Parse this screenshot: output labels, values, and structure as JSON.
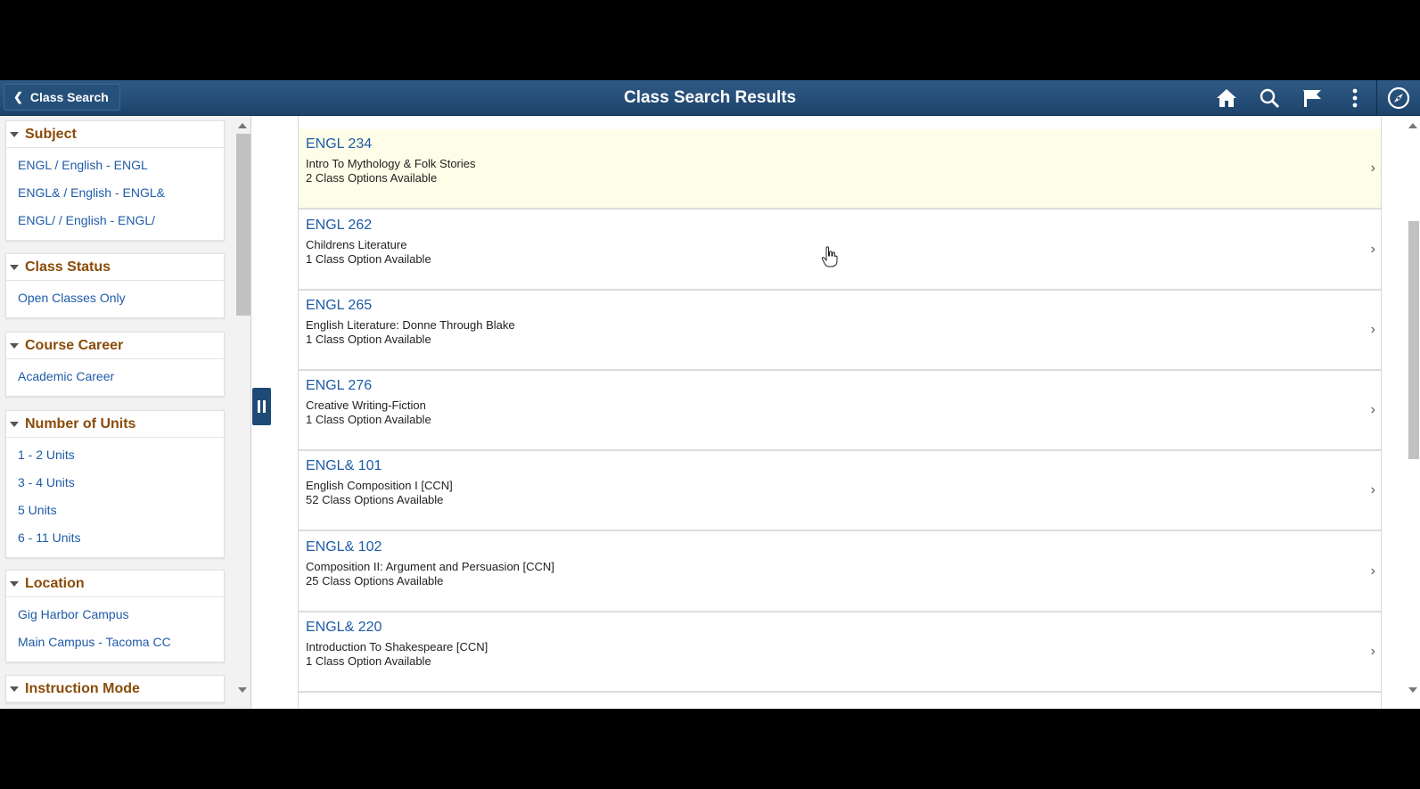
{
  "header": {
    "back_label": "Class Search",
    "title": "Class Search Results",
    "icons": [
      "home-icon",
      "search-icon",
      "flag-icon",
      "more-vertical-icon",
      "navigator-compass-icon"
    ]
  },
  "facets": [
    {
      "title": "Subject",
      "items": [
        "ENGL / English - ENGL",
        "ENGL& / English - ENGL&",
        "ENGL/ / English - ENGL/"
      ]
    },
    {
      "title": "Class Status",
      "items": [
        "Open Classes Only"
      ]
    },
    {
      "title": "Course Career",
      "items": [
        "Academic Career"
      ]
    },
    {
      "title": "Number of Units",
      "items": [
        "1 - 2 Units",
        "3 - 4 Units",
        "5 Units",
        "6 - 11 Units"
      ]
    },
    {
      "title": "Location",
      "items": [
        "Gig Harbor Campus",
        "Main Campus - Tacoma CC"
      ]
    },
    {
      "title": "Instruction Mode",
      "items": []
    }
  ],
  "results": [
    {
      "code": "ENGL 234",
      "name": "Intro To Mythology & Folk Stories",
      "options": "2 Class Options Available"
    },
    {
      "code": "ENGL 262",
      "name": "Childrens Literature",
      "options": "1 Class Option Available"
    },
    {
      "code": "ENGL 265",
      "name": "English Literature: Donne Through Blake",
      "options": "1 Class Option Available"
    },
    {
      "code": "ENGL 276",
      "name": "Creative Writing-Fiction",
      "options": "1 Class Option Available"
    },
    {
      "code": "ENGL& 101",
      "name": "English Composition I [CCN]",
      "options": "52 Class Options Available"
    },
    {
      "code": "ENGL& 102",
      "name": "Composition II: Argument and Persuasion [CCN]",
      "options": "25 Class Options Available"
    },
    {
      "code": "ENGL& 220",
      "name": "Introduction To Shakespeare [CCN]",
      "options": "1 Class Option Available"
    }
  ],
  "colors": {
    "banner": "#1d436b",
    "facet_title": "#8a4b08",
    "link": "#1f5ba7",
    "highlight_row": "#fdfde8"
  }
}
